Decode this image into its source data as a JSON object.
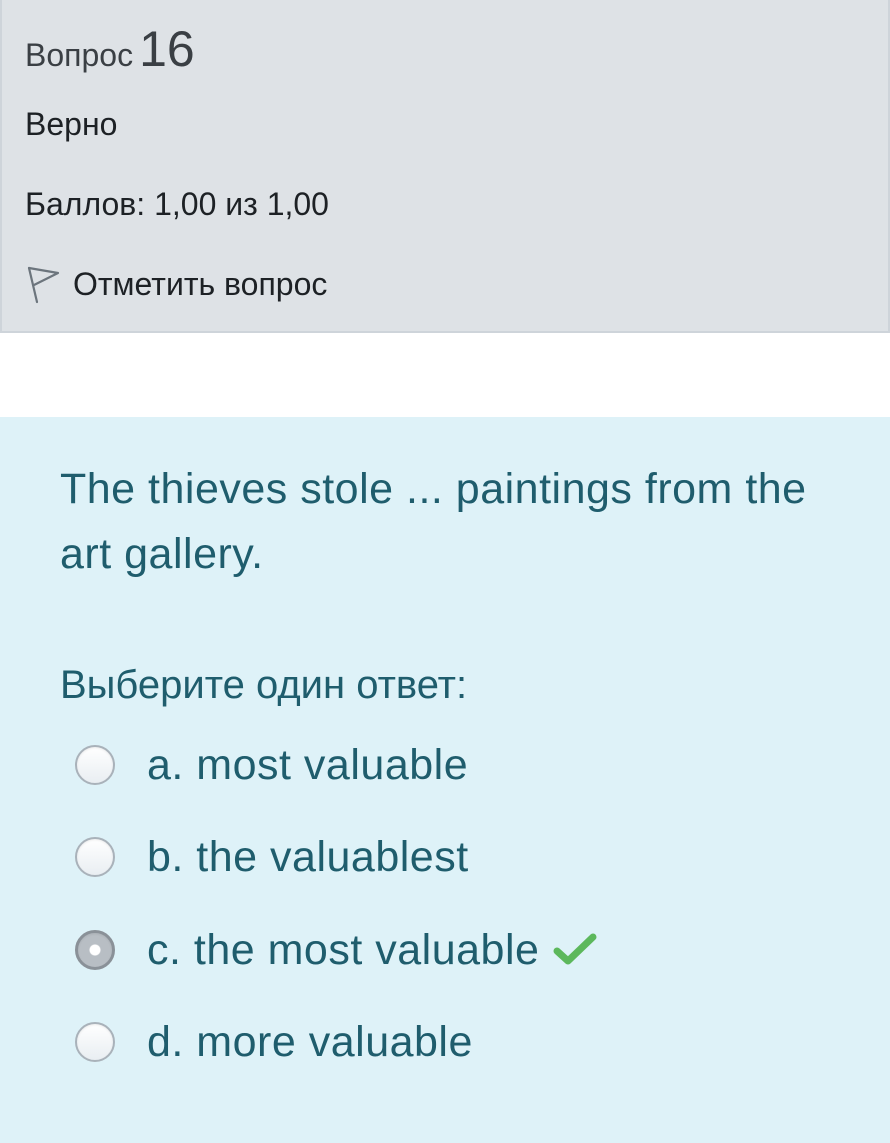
{
  "info": {
    "question_word": "Вопрос",
    "question_number": "16",
    "state": "Верно",
    "grade": "Баллов: 1,00 из 1,00",
    "flag_label": "Отметить вопрос",
    "flag_icon": "flag-outline-icon"
  },
  "question": {
    "text": "The thieves stole ... paintings from the art gallery.",
    "prompt": "Выберите один ответ:",
    "answers": [
      {
        "label": "a. most valuable",
        "selected": false,
        "correct_mark": false
      },
      {
        "label": "b. the valuablest",
        "selected": false,
        "correct_mark": false
      },
      {
        "label": "c. the most valuable",
        "selected": true,
        "correct_mark": true
      },
      {
        "label": "d. more valuable",
        "selected": false,
        "correct_mark": false
      }
    ],
    "check_icon": "checkmark-icon",
    "check_color": "#5cb85c"
  },
  "colors": {
    "info_background": "#dee2e6",
    "content_background": "#def2f8",
    "content_text": "#1f5d6d"
  }
}
